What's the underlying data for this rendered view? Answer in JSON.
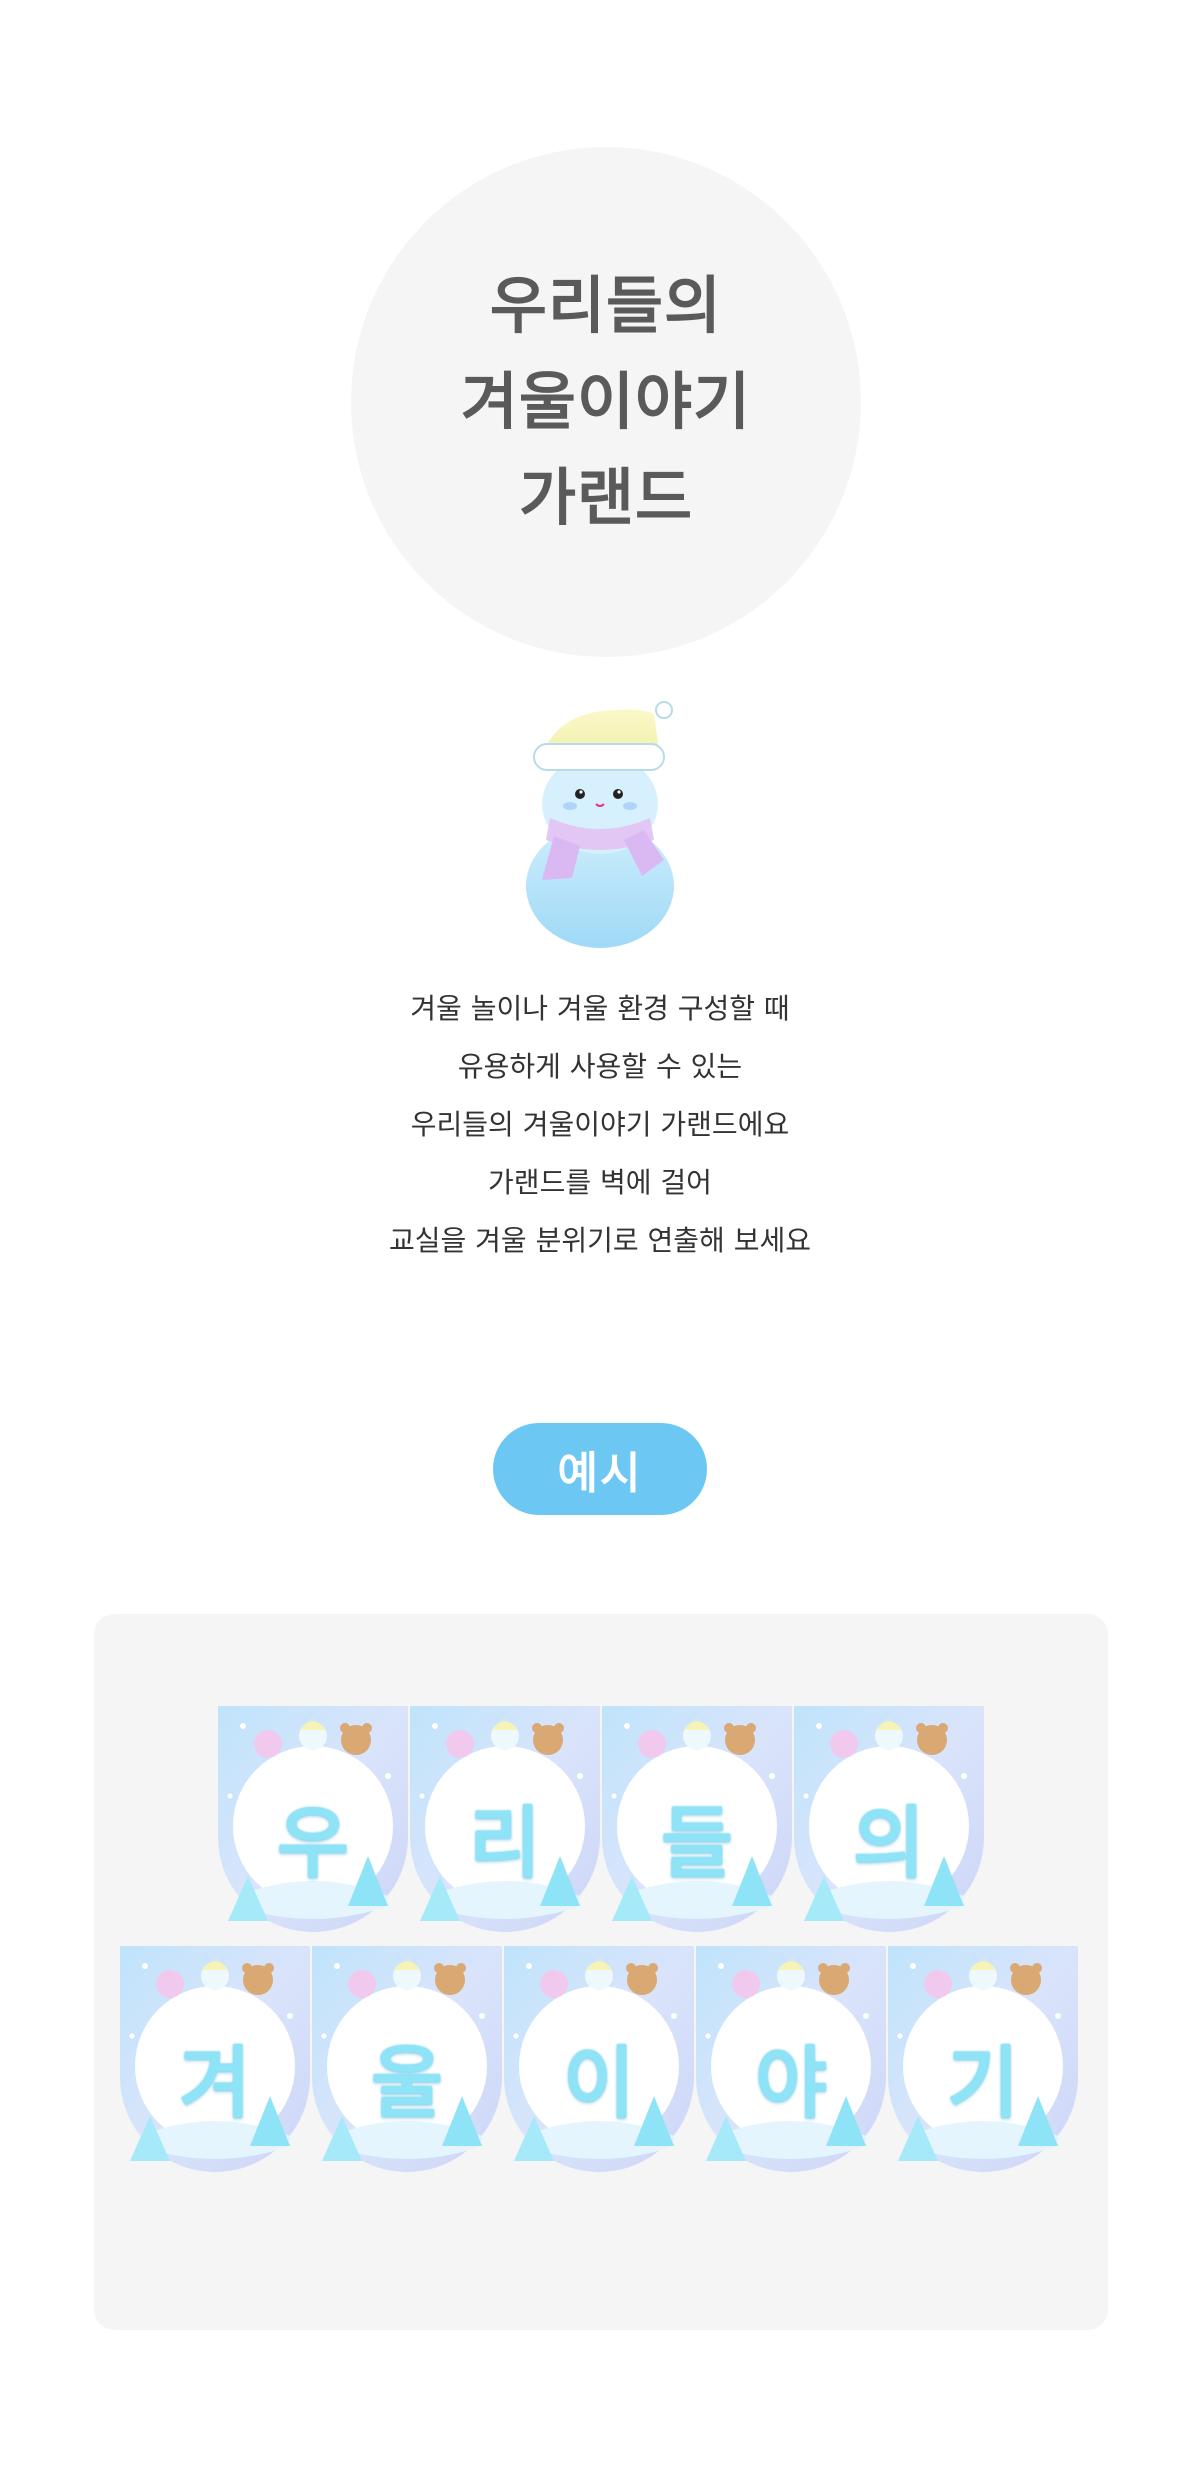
{
  "title": {
    "lines": [
      "우리들의",
      "겨울이야기",
      "가랜드"
    ]
  },
  "description": {
    "lines": [
      "겨울 놀이나 겨울 환경 구성할 때",
      "유용하게 사용할 수 있는",
      "우리들의 겨울이야기 가랜드에요",
      "가랜드를 벽에 걸어",
      "교실을 겨울 분위기로 연출해 보세요"
    ]
  },
  "example": {
    "label": "예시"
  },
  "garland": {
    "row1": [
      "우",
      "리",
      "들",
      "의"
    ],
    "row2": [
      "겨",
      "울",
      "이",
      "야",
      "기"
    ]
  },
  "colors": {
    "accent": "#6cc7f3",
    "letter": "#8fe3f7",
    "panel": "#f5f5f5",
    "title": "#5a5a5a"
  }
}
